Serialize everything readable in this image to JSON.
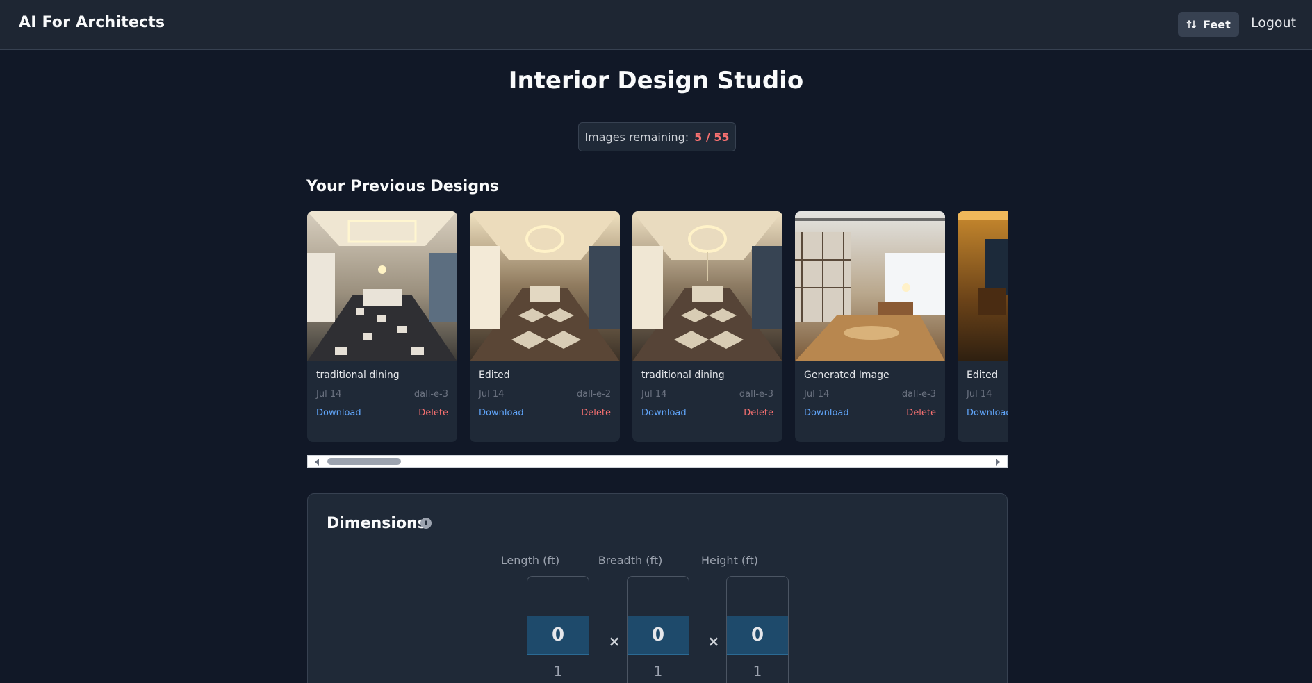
{
  "header": {
    "brand": "AI For Architects",
    "unit_toggle_label": "Feet",
    "logout_label": "Logout"
  },
  "page_title": "Interior Design Studio",
  "quota": {
    "label": "Images remaining:",
    "count": "5 / 55"
  },
  "gallery": {
    "title": "Your Previous Designs",
    "cards": [
      {
        "title": "traditional dining",
        "date": "Jul 14",
        "model": "dall-e-3",
        "download": "Download",
        "delete": "Delete"
      },
      {
        "title": "Edited",
        "date": "Jul 14",
        "model": "dall-e-2",
        "download": "Download",
        "delete": "Delete"
      },
      {
        "title": "traditional dining",
        "date": "Jul 14",
        "model": "dall-e-3",
        "download": "Download",
        "delete": "Delete"
      },
      {
        "title": "Generated Image",
        "date": "Jul 14",
        "model": "dall-e-3",
        "download": "Download",
        "delete": "Delete"
      },
      {
        "title": "Edited",
        "date": "Jul 14",
        "model": "",
        "download": "Download",
        "delete": ""
      }
    ]
  },
  "dimensions": {
    "title": "Dimensions",
    "info_icon": "i",
    "fields": [
      {
        "label": "Length (ft)",
        "value": "0",
        "next": "1"
      },
      {
        "label": "Breadth (ft)",
        "value": "0",
        "next": "1"
      },
      {
        "label": "Height (ft)",
        "value": "0",
        "next": "1"
      }
    ],
    "separator": "×"
  },
  "icons": {
    "unit_toggle": "swap-vertical-icon",
    "info": "info-icon"
  }
}
